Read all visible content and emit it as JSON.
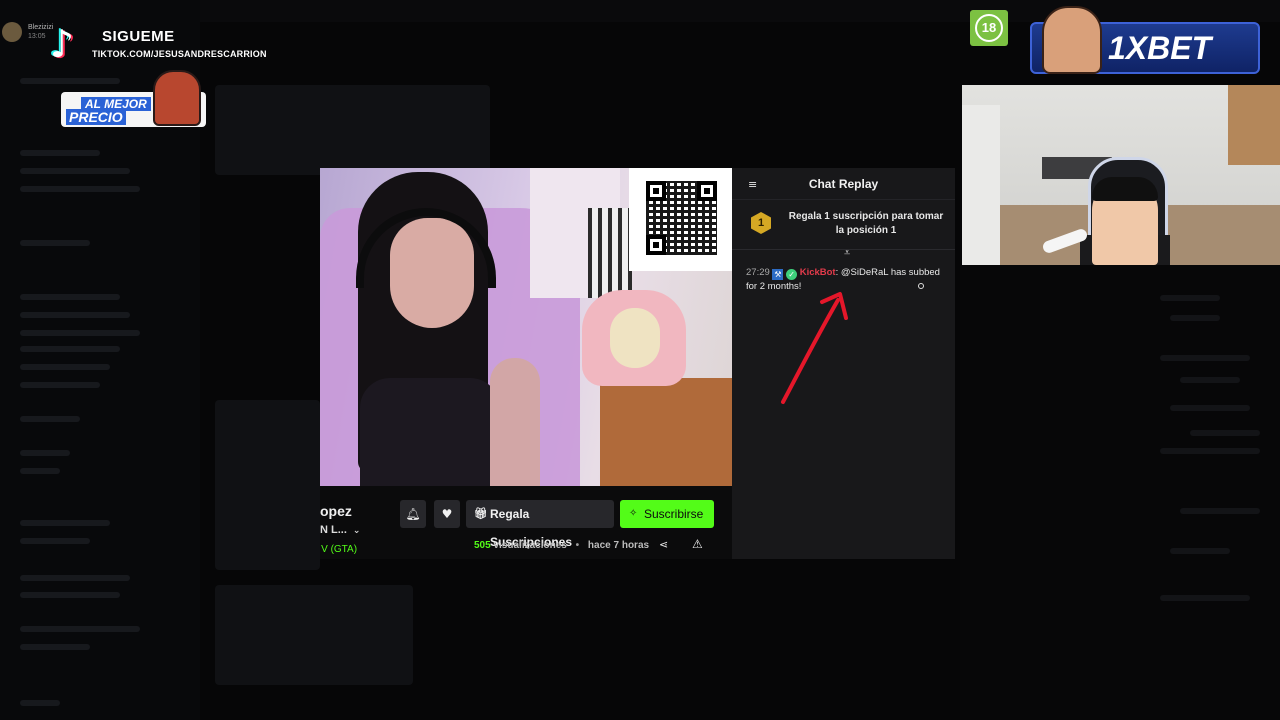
{
  "overlay": {
    "tiktok_title": "SIGUEME",
    "tiktok_handle": "TIKTOK.COM/JESUSANDRESCARRION",
    "promo_line1": "AL MEJOR",
    "promo_line2": "PRECIO",
    "streamer_name": "Blezizizi",
    "streamer_sub": "13:05",
    "age_badge": "18",
    "sponsor": "1XBET"
  },
  "chat": {
    "menu_icon": "menu-icon",
    "title": "Chat Replay",
    "gift_rank": "1",
    "gift_text": "Regala 1 suscripción para tomar la posición 1",
    "pin_icon": "pin-icon",
    "message": {
      "time": "27:29",
      "username": "KickBot",
      "text": ": @SiDeRaL has subbed for 2 months!"
    }
  },
  "channel": {
    "name": "opez",
    "subtitle": "N L...",
    "category": "to V (GTA)",
    "gift_button": "Regala Suscripciones",
    "subscribe_button": "Suscribirse",
    "views_count": "505",
    "views_label": "visualizaciones",
    "time_ago": "hace 7 horas"
  },
  "colors": {
    "kick_green": "#53fc18",
    "bot_red": "#e33b4b",
    "annotation_red": "#e5172a"
  }
}
